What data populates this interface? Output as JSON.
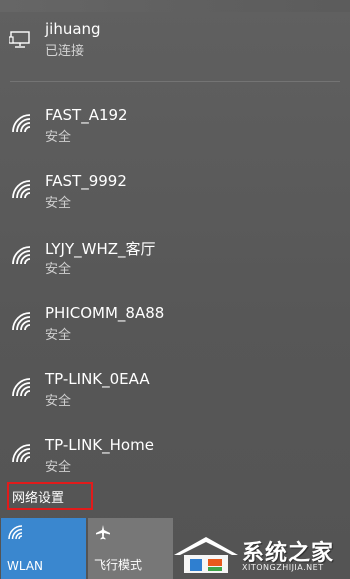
{
  "connected_network": {
    "name": "jihuang",
    "status": "已连接",
    "icon": "ethernet-icon"
  },
  "wifi_networks": [
    {
      "ssid": "FAST_A192",
      "security": "安全",
      "icon": "wifi-signal-icon"
    },
    {
      "ssid": "FAST_9992",
      "security": "安全",
      "icon": "wifi-signal-icon"
    },
    {
      "ssid": "LYJY_WHZ_客厅",
      "security": "安全",
      "icon": "wifi-signal-icon"
    },
    {
      "ssid": "PHICOMM_8A88",
      "security": "安全",
      "icon": "wifi-signal-icon"
    },
    {
      "ssid": "TP-LINK_0EAA",
      "security": "安全",
      "icon": "wifi-signal-icon"
    },
    {
      "ssid": "TP-LINK_Home",
      "security": "安全",
      "icon": "wifi-signal-icon"
    }
  ],
  "settings_link": {
    "label": "网络设置",
    "highlight_color": "#e21b1b"
  },
  "quick_actions": {
    "wlan": {
      "label": "WLAN",
      "active": true,
      "color": "#3a87cf",
      "icon": "wifi-icon"
    },
    "airplane": {
      "label": "飞行模式",
      "active": false,
      "color": "#777777",
      "icon": "airplane-icon"
    }
  },
  "watermark": {
    "title": "系统之家",
    "url": "XITONGZHIJIA.NET"
  }
}
